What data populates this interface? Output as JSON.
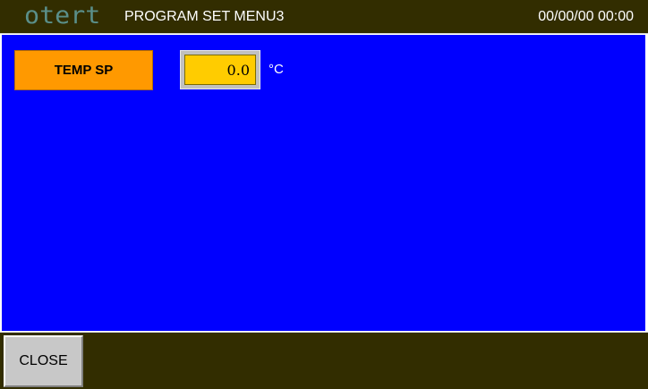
{
  "header": {
    "logo_text": "otert",
    "title": "PROGRAM SET MENU3",
    "datetime": "00/00/00 00:00"
  },
  "main": {
    "temp_sp": {
      "label": "TEMP SP",
      "value": "0.0",
      "unit": "°C"
    }
  },
  "footer": {
    "close_label": "CLOSE"
  },
  "colors": {
    "header_bg": "#322d00",
    "main_bg": "#0000ff",
    "label_bg": "#ff9900",
    "value_bg": "#ffcc00",
    "button_bg": "#c8c8c8"
  }
}
